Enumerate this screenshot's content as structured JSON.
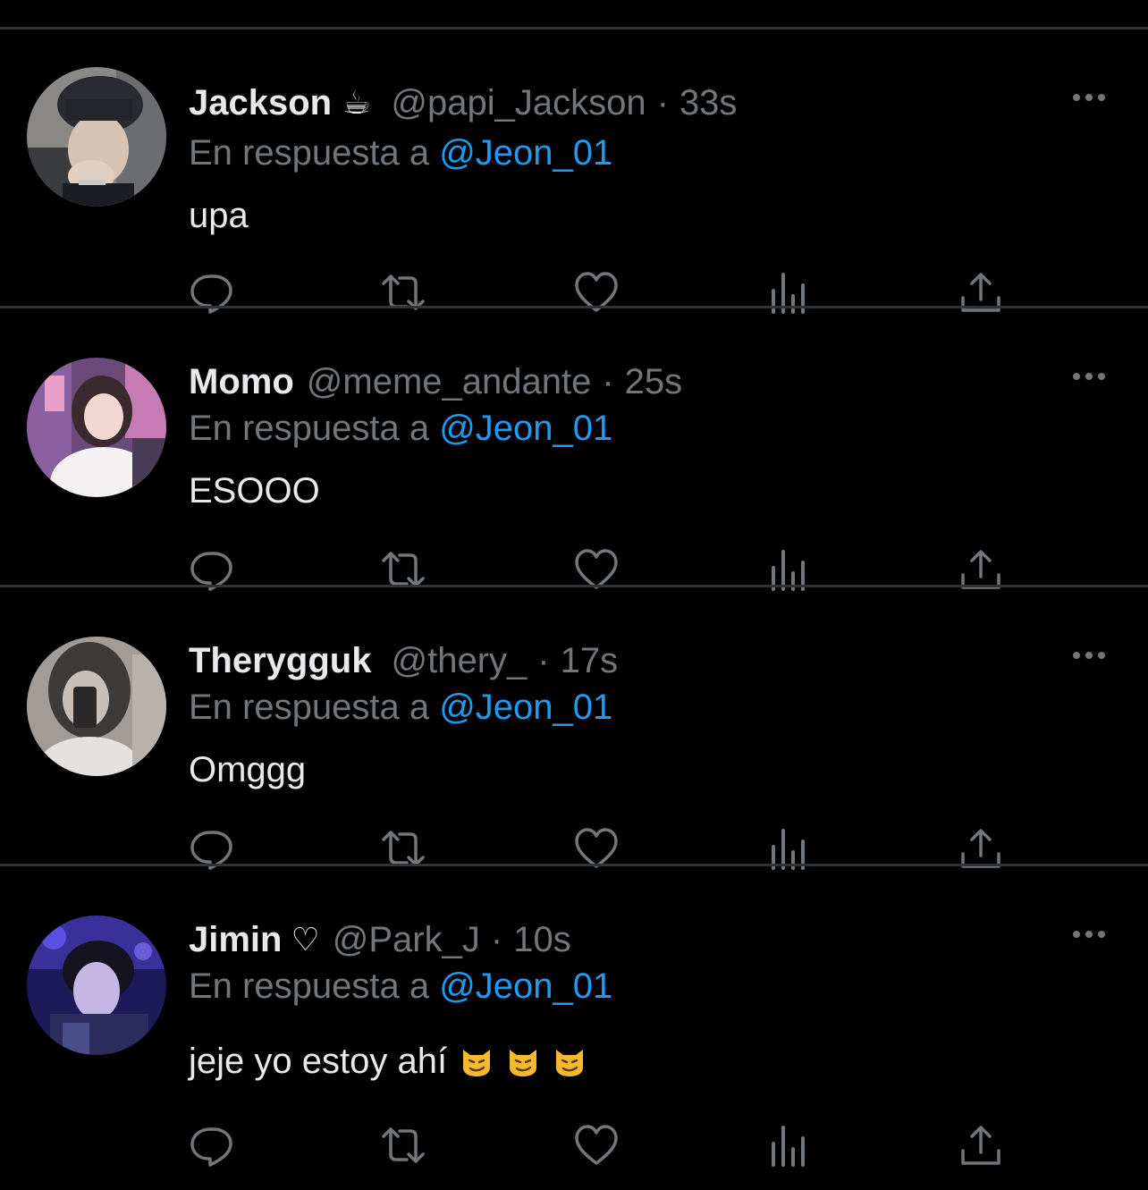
{
  "reply_prefix": "En respuesta a",
  "tweets": [
    {
      "name": "Jackson",
      "badge": "☕",
      "handle": "@papi_Jackson",
      "separator": "·",
      "time": "33s",
      "reply_to": "@Jeon_01",
      "text": "upa"
    },
    {
      "name": "Momo",
      "badge": "",
      "handle": "@meme_andante",
      "separator": "·",
      "time": "25s",
      "reply_to": "@Jeon_01",
      "text": "ESOOO"
    },
    {
      "name": "Therygguk",
      "badge": "",
      "handle": "@thery_",
      "separator": "·",
      "time": "17s",
      "reply_to": "@Jeon_01",
      "text": "Omggg"
    },
    {
      "name": "Jimin",
      "badge": "♡",
      "handle": "@Park_J",
      "separator": "·",
      "time": "10s",
      "reply_to": "@Jeon_01",
      "text": "jeje yo estoy ahí",
      "emojis": [
        "smirking-cat-emoji",
        "smirking-cat-emoji",
        "smirking-cat-emoji"
      ]
    }
  ],
  "colors": {
    "background": "#000000",
    "primary_text": "#e7e9ea",
    "secondary_text": "#71767b",
    "link": "#1d9bf0",
    "divider": "#2f3336"
  },
  "icons": {
    "more": "more-horizontal-icon",
    "reply": "reply-icon",
    "retweet": "retweet-icon",
    "like": "heart-icon",
    "views": "views-icon",
    "share": "share-icon"
  }
}
